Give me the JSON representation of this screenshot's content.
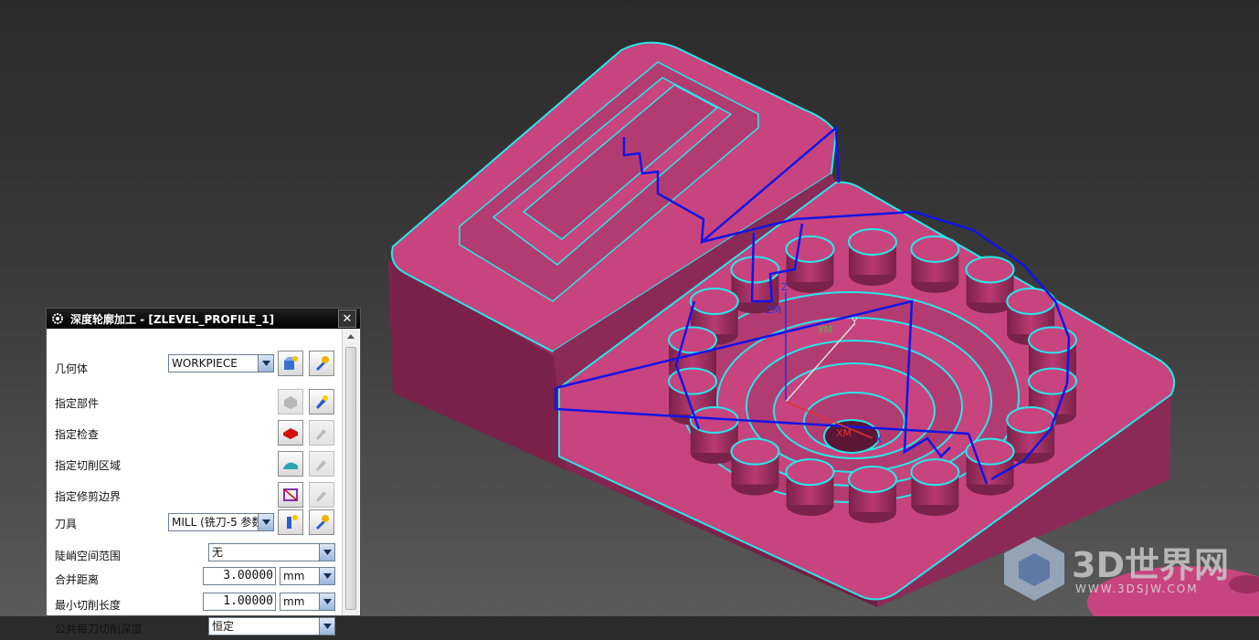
{
  "dialog": {
    "title": "深度轮廓加工 - [ZLEVEL_PROFILE_1]",
    "close_label": "✕",
    "rows": {
      "geometry": {
        "label": "几何体",
        "value": "WORKPIECE"
      },
      "specify_part": {
        "label": "指定部件"
      },
      "specify_check": {
        "label": "指定检查"
      },
      "specify_cut_area": {
        "label": "指定切削区域"
      },
      "specify_trim": {
        "label": "指定修剪边界"
      },
      "tool": {
        "label": "刀具",
        "value": "MILL (铣刀-5 参数"
      },
      "steep_range": {
        "label": "陡峭空间范围",
        "value": "无"
      },
      "merge_distance": {
        "label": "合并距离",
        "value": "3.00000",
        "unit": "mm"
      },
      "min_cut_length": {
        "label": "最小切削长度",
        "value": "1.00000",
        "unit": "mm"
      },
      "common_depth": {
        "label": "公共每刀切削深度",
        "value": "恒定"
      }
    }
  },
  "viewport": {
    "axis_labels": {
      "z": "Z",
      "zm": "ZM",
      "ym": "YM",
      "y": "Y",
      "xm": "XM",
      "x": "X"
    }
  },
  "watermark": {
    "brand": "3D世界网",
    "url": "WWW.3DSJW.COM"
  },
  "colors": {
    "part": "#c8447e",
    "part_dark": "#7a2249",
    "part_side": "#9b2f5f",
    "edge": "#29e6ea",
    "toolpath": "#1414e6"
  }
}
